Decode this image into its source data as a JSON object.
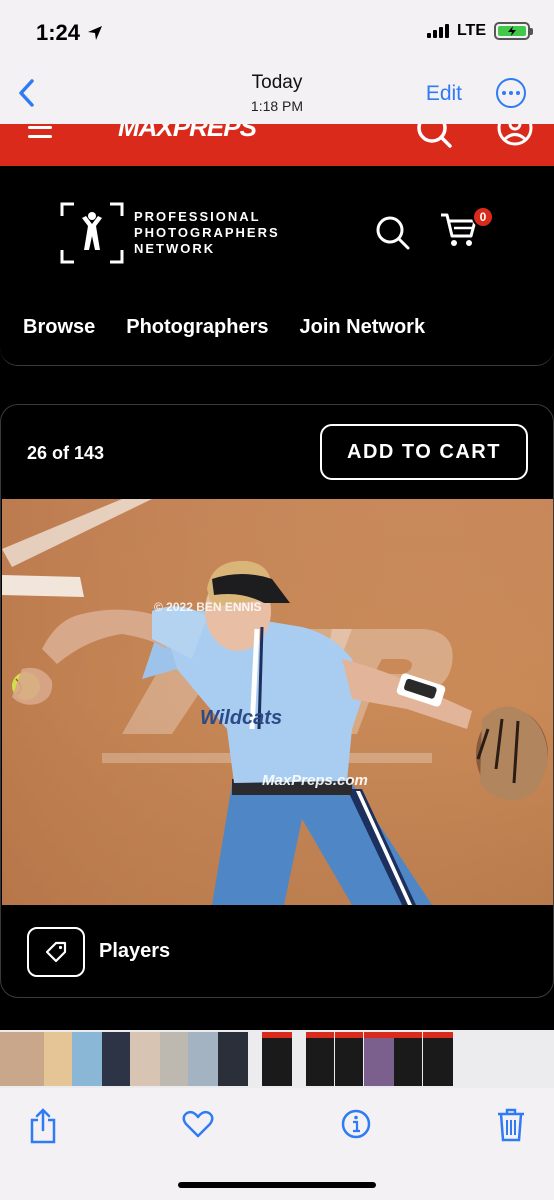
{
  "status": {
    "time": "1:24",
    "network": "LTE"
  },
  "photos_nav": {
    "title": "Today",
    "subtitle": "1:18 PM",
    "edit_label": "Edit"
  },
  "maxpreps": {
    "logo": "MAXPREPS"
  },
  "ppn": {
    "logo_lines": [
      "PROFESSIONAL",
      "PHOTOGRAPHERS",
      "NETWORK"
    ],
    "cart_count": "0",
    "nav": [
      "Browse",
      "Photographers",
      "Join Network"
    ]
  },
  "photo_card": {
    "counter": "26 of 143",
    "add_to_cart": "ADD TO CART",
    "copyright": "© 2022 BEN ENNIS",
    "watermark_site": "MaxPreps.com",
    "watermark_logo": "MP",
    "jersey_text": "Wildcats",
    "tag_label": "Players"
  },
  "colors": {
    "accent_red": "#d92a1c",
    "ios_blue": "#2f7bf5"
  },
  "icons": [
    "location-arrow-icon",
    "back-chevron-icon",
    "more-icon",
    "menu-icon",
    "search-icon",
    "user-icon",
    "cart-icon",
    "tag-icon",
    "share-icon",
    "heart-icon",
    "info-icon",
    "trash-icon"
  ]
}
